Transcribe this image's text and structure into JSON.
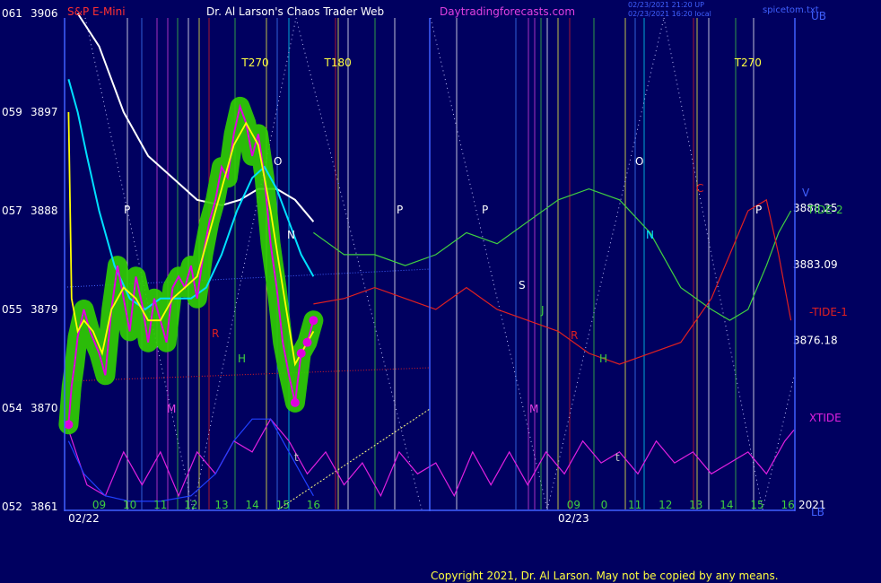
{
  "header": {
    "symbol": "S&P E-Mini",
    "title": "Dr. Al Larson's Chaos Trader Web",
    "site": "Daytradingforecasts.com",
    "stamp1": "02/23/2021 21:20 UP",
    "stamp2": "02/23/2021 16:20 local",
    "brand": "spicetom.txt",
    "corner": "UB",
    "corner_bottom": "LB"
  },
  "footer": {
    "copyright": "Copyright 2021, Dr. Al Larson. May not be copied by any means."
  },
  "colors": {
    "background": "#000060",
    "price_halo": "#30d000",
    "price": "#e000e0",
    "fast_ma": "#ffff00",
    "slow_ma": "#00e0ff",
    "long_ma": "#ffffff",
    "tide1": "#e02020",
    "tide2": "#40d040",
    "xtide": "#e020e0",
    "blue_curve": "#2040ff"
  },
  "chart_data": {
    "type": "line",
    "y_axis_left": [
      {
        "index": "061",
        "price": 3906
      },
      {
        "index": "059",
        "price": 3897
      },
      {
        "index": "057",
        "price": 3888
      },
      {
        "index": "055",
        "price": 3879
      },
      {
        "index": "054",
        "price": 3870
      },
      {
        "index": "052",
        "price": 3861
      }
    ],
    "ylim": [
      3861,
      3906
    ],
    "x_hour_labels": [
      {
        "label": "09",
        "hour": 9
      },
      {
        "label": "10",
        "hour": 10
      },
      {
        "label": "11",
        "hour": 11
      },
      {
        "label": "12",
        "hour": 12
      },
      {
        "label": "13",
        "hour": 13
      },
      {
        "label": "14",
        "hour": 14
      },
      {
        "label": "15",
        "hour": 15
      },
      {
        "label": "16",
        "hour": 16
      },
      {
        "label": "09",
        "hour": 24.5
      },
      {
        "label": "0",
        "hour": 25.5
      },
      {
        "label": "11",
        "hour": 26.5
      },
      {
        "label": "12",
        "hour": 27.5
      },
      {
        "label": "13",
        "hour": 28.5
      },
      {
        "label": "14",
        "hour": 29.5
      },
      {
        "label": "15",
        "hour": 30.5
      },
      {
        "label": "16",
        "hour": 31.5
      }
    ],
    "x_dates": [
      {
        "label": "02/22",
        "hour": 8.5
      },
      {
        "label": "02/23",
        "hour": 24.5
      }
    ],
    "xlim": [
      7.9,
      31.7
    ],
    "year_label": "2021",
    "right_levels": [
      {
        "label": "3888.25",
        "price": 3888.25
      },
      {
        "label": "3883.09",
        "price": 3883.09
      },
      {
        "label": "3876.18",
        "price": 3876.18
      }
    ],
    "curve_labels": [
      "TIDE-2",
      "-TIDE-1",
      "XTIDE"
    ],
    "time_markers": [
      {
        "label": "T270",
        "hour": 14.1
      },
      {
        "label": "T180",
        "hour": 16.8
      },
      {
        "label": "T270",
        "hour": 30.2
      }
    ],
    "planet_letters": [
      "P",
      "O",
      "N",
      "P",
      "P",
      "S",
      "J",
      "R",
      "H",
      "M",
      "O",
      "N",
      "C",
      "P",
      "M",
      "R",
      "H",
      "t",
      "t",
      "V"
    ],
    "price": {
      "x": [
        8.0,
        8.1,
        8.2,
        8.3,
        8.5,
        8.7,
        9.0,
        9.2,
        9.4,
        9.6,
        9.8,
        10.0,
        10.2,
        10.4,
        10.6,
        10.8,
        11.0,
        11.2,
        11.4,
        11.6,
        11.8,
        12.0,
        12.2,
        12.4,
        12.6,
        12.8,
        13.0,
        13.2,
        13.4,
        13.6,
        13.8,
        14.0,
        14.2,
        14.4,
        14.6,
        14.8,
        15.0,
        15.2,
        15.4,
        15.6,
        15.8,
        16.0
      ],
      "y": [
        3868.5,
        3872,
        3874,
        3876.5,
        3879,
        3877,
        3875,
        3873,
        3879,
        3883,
        3880,
        3877,
        3882,
        3879.5,
        3876,
        3880,
        3878,
        3876,
        3881,
        3882,
        3881,
        3883,
        3880,
        3884,
        3887,
        3889,
        3892,
        3891,
        3895,
        3897.5,
        3896,
        3893,
        3895,
        3891,
        3885,
        3881,
        3876,
        3873,
        3870.5,
        3875,
        3876,
        3878
      ]
    },
    "fast_ma": {
      "x": [
        8.0,
        8.1,
        8.3,
        8.5,
        8.8,
        9.1,
        9.4,
        9.8,
        10.2,
        10.6,
        11.0,
        11.4,
        11.8,
        12.2,
        12.6,
        13.0,
        13.4,
        13.8,
        14.2,
        14.6,
        15.0,
        15.4,
        15.8,
        16.0
      ],
      "y": [
        3897,
        3880,
        3877,
        3878,
        3877,
        3875,
        3879,
        3881,
        3880,
        3878,
        3878,
        3880,
        3881,
        3882,
        3886,
        3890,
        3894,
        3896,
        3894,
        3888,
        3881,
        3874,
        3876,
        3877
      ]
    },
    "slow_ma": {
      "x": [
        8.0,
        8.3,
        8.6,
        9.0,
        9.5,
        10.0,
        10.5,
        11.0,
        11.5,
        12.0,
        12.5,
        13.0,
        13.5,
        14.0,
        14.4,
        14.8,
        15.2,
        15.6,
        16.0
      ],
      "y": [
        3900,
        3897,
        3893,
        3888,
        3883,
        3880,
        3879,
        3880,
        3880,
        3880,
        3881,
        3884,
        3888,
        3891,
        3892,
        3890,
        3887,
        3884,
        3882
      ]
    },
    "long_ma": {
      "x": [
        8.3,
        9.0,
        9.8,
        10.6,
        11.4,
        12.2,
        13.0,
        13.6,
        14.2,
        14.8,
        15.4,
        16.0
      ],
      "y": [
        3906,
        3903,
        3897,
        3893,
        3891,
        3889,
        3888.5,
        3889,
        3890,
        3890,
        3889,
        3887
      ]
    },
    "tide_1": {
      "x": [
        16.0,
        17.0,
        18.0,
        19.0,
        20.0,
        21.0,
        22.0,
        23.0,
        24.0,
        25.0,
        26.0,
        27.0,
        28.0,
        29.0,
        29.6,
        30.2,
        30.8,
        31.2,
        31.6
      ],
      "y": [
        3879.5,
        3880,
        3881,
        3880,
        3879,
        3881,
        3879,
        3878,
        3877,
        3875,
        3874,
        3875,
        3876,
        3880,
        3884,
        3888,
        3889,
        3884,
        3878
      ]
    },
    "tide_2": {
      "x": [
        16.0,
        17.0,
        18.0,
        19.0,
        20.0,
        21.0,
        22.0,
        23.0,
        24.0,
        25.0,
        26.0,
        27.0,
        28.0,
        29.0,
        29.6,
        30.2,
        30.8,
        31.2,
        31.6
      ],
      "y": [
        3886,
        3884,
        3884,
        3883,
        3884,
        3886,
        3885,
        3887,
        3889,
        3890,
        3889,
        3886,
        3881,
        3879,
        3878,
        3879,
        3883,
        3886,
        3888
      ]
    },
    "xtide": {
      "x": [
        8.0,
        8.6,
        9.2,
        9.8,
        10.4,
        11.0,
        11.6,
        12.2,
        12.8,
        13.4,
        14.0,
        14.6,
        15.2,
        15.8,
        16.4,
        17.0,
        17.6,
        18.2,
        18.8,
        19.4,
        20.0,
        20.6,
        21.2,
        21.8,
        22.4,
        23.0,
        23.6,
        24.2,
        24.8,
        25.4,
        26.0,
        26.6,
        27.2,
        27.8,
        28.4,
        29.0,
        29.6,
        30.2,
        30.8,
        31.4,
        31.7
      ],
      "y": [
        3868,
        3863,
        3862,
        3866,
        3863,
        3866,
        3862,
        3866,
        3864,
        3867,
        3866,
        3869,
        3867,
        3864,
        3866,
        3863,
        3865,
        3862,
        3866,
        3864,
        3865,
        3862,
        3866,
        3863,
        3866,
        3863,
        3866,
        3864,
        3867,
        3865,
        3866,
        3864,
        3867,
        3865,
        3866,
        3864,
        3865,
        3866,
        3864,
        3867,
        3868
      ]
    },
    "blue_curve": {
      "x": [
        8.0,
        8.5,
        9.2,
        10.0,
        11.0,
        12.0,
        12.8,
        13.4,
        14.0,
        14.6,
        15.2,
        15.8,
        16.0
      ],
      "y": [
        3867,
        3864,
        3862,
        3861.5,
        3861.5,
        3862,
        3864,
        3867,
        3869,
        3869,
        3866,
        3863,
        3862
      ]
    }
  }
}
